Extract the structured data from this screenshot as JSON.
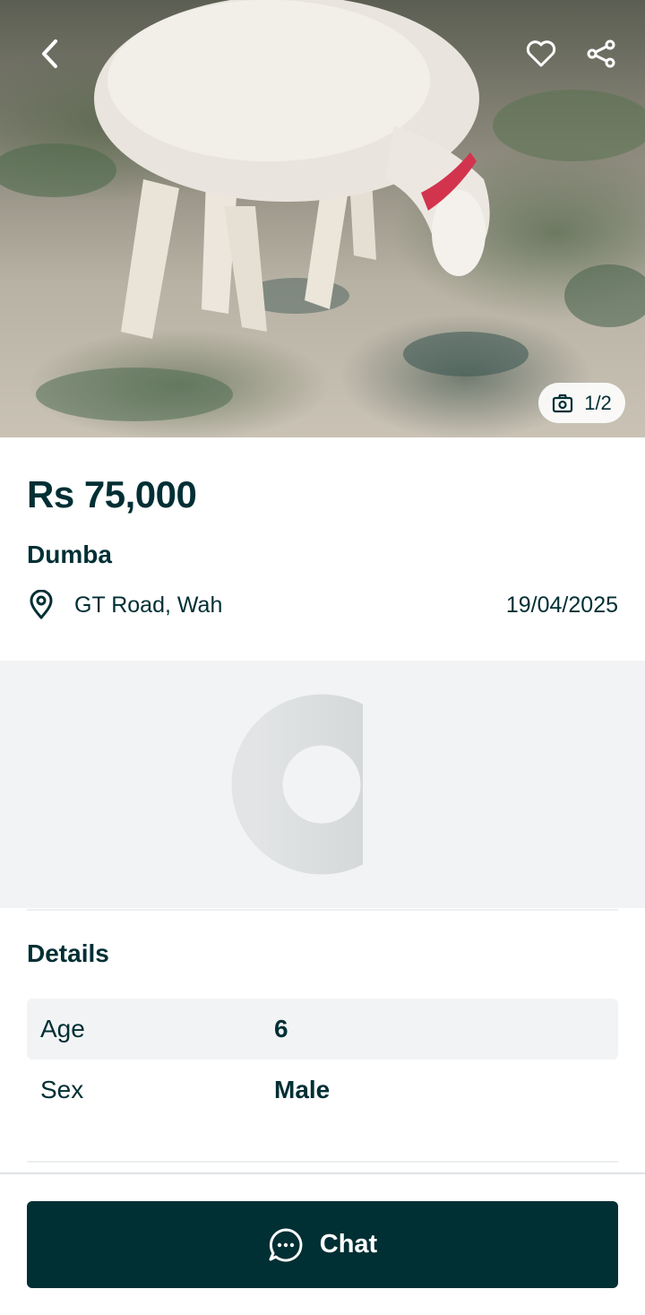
{
  "hero": {
    "image_description_icon": "sheep-photo",
    "counter": "1/2",
    "icons": {
      "back": "chevron-left-icon",
      "favorite": "heart-icon",
      "share": "share-icon",
      "camera": "camera-icon"
    }
  },
  "listing": {
    "price": "Rs 75,000",
    "title": "Dumba",
    "location": "GT Road, Wah",
    "date": "19/04/2025"
  },
  "details": {
    "heading": "Details",
    "rows": [
      {
        "label": "Age",
        "value": "6"
      },
      {
        "label": "Sex",
        "value": "Male"
      }
    ]
  },
  "actions": {
    "chat_label": "Chat"
  },
  "colors": {
    "primary": "#002f34",
    "row_bg": "#f2f3f5",
    "background": "#ffffff"
  }
}
